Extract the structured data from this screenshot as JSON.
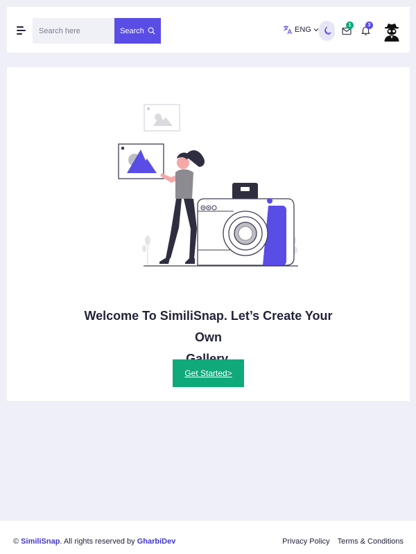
{
  "header": {
    "search": {
      "placeholder": "Search here",
      "button_label": "Search"
    },
    "language": {
      "label": "ENG"
    },
    "messages_count": "1",
    "notifications_count": "3",
    "colors": {
      "accent": "#5a4de6",
      "messages_badge": "#10a97a",
      "notifications_badge": "#5a4de6"
    }
  },
  "main": {
    "welcome_line1": "Welcome To SimiliSnap. Let’s Create Your Own",
    "welcome_line2": "Gallery.",
    "cta_label": "Get Started>",
    "cta_color": "#10a97a"
  },
  "footer": {
    "copyright_prefix": "© ",
    "brand": "SimiliSnap",
    "rights_text": ". All rights reserved by ",
    "author": "GharbiDev",
    "links": [
      "Privacy Policy",
      "Terms & Conditions"
    ]
  }
}
